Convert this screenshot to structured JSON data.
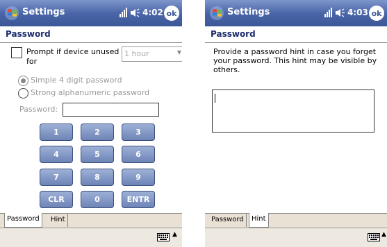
{
  "left": {
    "title": "Settings",
    "time": "4:02",
    "ok": "ok",
    "heading": "Password",
    "prompt_label": "Prompt if device unused for",
    "dropdown_value": "1 hour",
    "radio_simple": "Simple 4 digit password",
    "radio_strong": "Strong alphanumeric password",
    "password_label": "Password:",
    "password_value": "",
    "keys": [
      "1",
      "2",
      "3",
      "4",
      "5",
      "6",
      "7",
      "8",
      "9",
      "CLR",
      "0",
      "ENTR"
    ],
    "tabs": [
      "Password",
      "Hint"
    ],
    "active_tab": "Password"
  },
  "right": {
    "title": "Settings",
    "time": "4:03",
    "ok": "ok",
    "heading": "Password",
    "hint_text": "Provide a password hint in case you forget your password.  This hint may be visible by others.",
    "hint_value": "",
    "tabs": [
      "Password",
      "Hint"
    ],
    "active_tab": "Hint"
  },
  "icons": {
    "windows_logo": "windows-flag-icon",
    "signal": "signal-icon",
    "volume": "speaker-icon",
    "keyboard": "keyboard-icon",
    "sip_arrow": "up-arrow-icon"
  },
  "colors": {
    "titlebar": "#4b66a8",
    "key": "#7d93c4",
    "tabstrip": "#e9e1d4",
    "heading": "#1c2c6b"
  }
}
